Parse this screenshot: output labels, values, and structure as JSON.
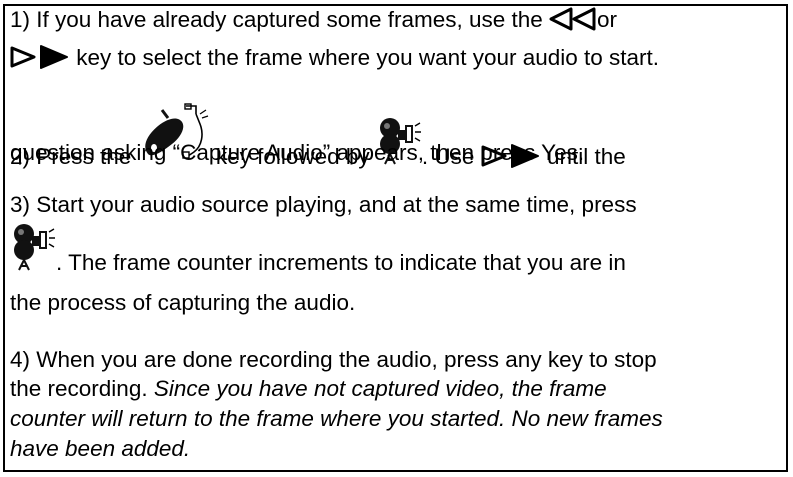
{
  "steps": [
    {
      "line1": {
        "a": "1) If you have already captured some frames, use the ",
        "b": "or"
      },
      "line2": {
        "a": " key to select the frame where you want your audio to start."
      }
    },
    {
      "line1": {
        "a": "2) Press the ",
        "b": " key followed by ",
        "c": ". Use ",
        "d": " until the"
      },
      "line2": {
        "a": "question asking “Capture Audio” appears, then press Yes."
      }
    },
    {
      "line1": {
        "a": "3) Start your audio source playing, and at the same time, press"
      },
      "line2": {
        "a": ".  The frame counter increments to indicate that you are in"
      },
      "line3": {
        "a": "the process of capturing the audio."
      }
    },
    {
      "line1": {
        "a": "4) When you are done recording the audio, press any key to stop"
      },
      "line2": {
        "a": "the recording. ",
        "b": "Since you have not captured video, the frame"
      },
      "line3": {
        "a": "counter will return to the frame where you started. No new frames"
      },
      "line4": {
        "a": "have been added."
      }
    }
  ],
  "icons": {
    "rewind": "rewind-icon",
    "forward": "fast-forward-icon",
    "audio_key": "audio-record-key-icon",
    "camera": "capture-camera-icon"
  }
}
